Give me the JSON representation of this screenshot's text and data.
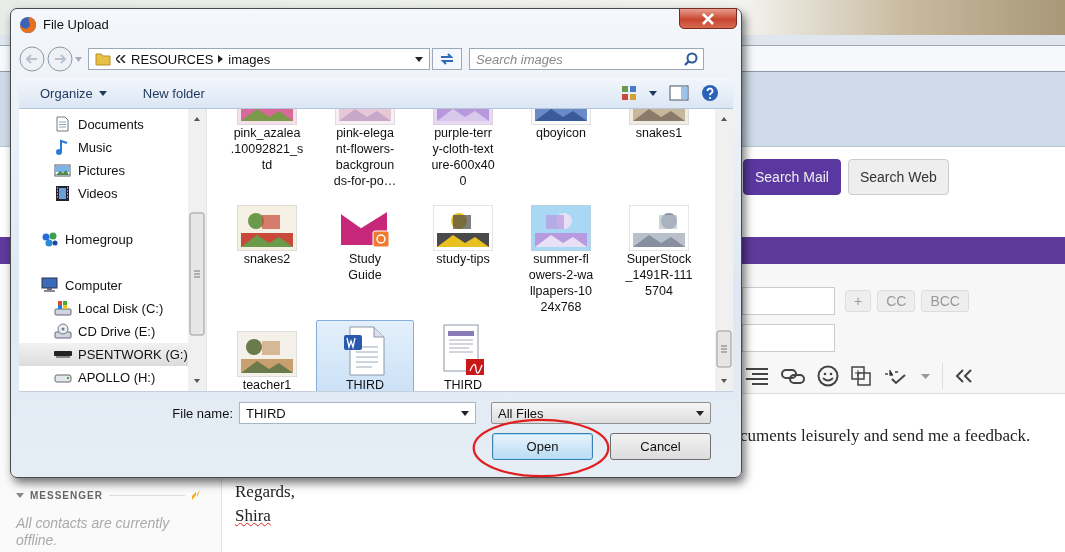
{
  "mail": {
    "search_buttons": [
      {
        "label": "Search Mail",
        "selected": true
      },
      {
        "label": "Search Web",
        "selected": false
      }
    ],
    "recipient_buttons": [
      "+",
      "CC",
      "BCC"
    ],
    "body": {
      "fragment": "cuments leisurely and send me a feedback.",
      "closing": "Regards,",
      "signature": "Shira",
      "signature_misspelled": true
    },
    "messenger": {
      "title": "MESSENGER",
      "status": "All contacts are currently offline."
    }
  },
  "dialog": {
    "title": "File Upload",
    "path": [
      "RESOURCES",
      "images"
    ],
    "search": {
      "placeholder": "Search images"
    },
    "toolbar": [
      {
        "label": "Organize",
        "kind": "menu"
      },
      {
        "label": "New folder",
        "kind": "button"
      }
    ],
    "nav": [
      {
        "children": [
          {
            "label": "Documents",
            "kind": "documents",
            "selected": false
          },
          {
            "label": "Music",
            "kind": "music",
            "selected": false
          },
          {
            "label": "Pictures",
            "kind": "pictures",
            "selected": false
          },
          {
            "label": "Videos",
            "kind": "videos",
            "selected": false
          }
        ]
      },
      {
        "label": "Homegroup",
        "kind": "homegroup",
        "selected": false
      },
      {
        "label": "Computer",
        "kind": "computer",
        "selected": false,
        "children": [
          {
            "label": "Local Disk (C:)",
            "kind": "system-drive",
            "selected": false
          },
          {
            "label": "CD Drive (E:)",
            "kind": "cd-drive",
            "selected": false
          },
          {
            "label": "PSENTWORK (G:)",
            "kind": "network-drive",
            "selected": true
          },
          {
            "label": "APOLLO (H:)",
            "kind": "usb-drive",
            "selected": false
          }
        ]
      }
    ],
    "files": [
      {
        "name": "pink_azalea\n.10092821_s\ntd",
        "kind": "picture",
        "selected": false
      },
      {
        "name": "pink-elega\nnt-flowers-\nbackgroun\nds-for-po…",
        "kind": "picture",
        "selected": false
      },
      {
        "name": "purple-terr\ny-cloth-text\nure-600x40\n0",
        "kind": "picture",
        "selected": false
      },
      {
        "name": "qboyicon",
        "kind": "picture",
        "selected": false
      },
      {
        "name": "snakes1",
        "kind": "picture",
        "selected": false
      },
      {
        "name": "snakes2",
        "kind": "picture",
        "selected": false
      },
      {
        "name": "Study\nGuide",
        "kind": "presentation",
        "selected": false
      },
      {
        "name": "study-tips",
        "kind": "picture",
        "selected": false
      },
      {
        "name": "summer-fl\nowers-2-wa\nllpapers-10\n24x768",
        "kind": "picture",
        "selected": false
      },
      {
        "name": "SuperStock\n_1491R-111\n5704",
        "kind": "picture",
        "selected": false
      },
      {
        "name": "teacher1",
        "kind": "picture",
        "selected": false
      },
      {
        "name": "THIRD",
        "kind": "word",
        "selected": true
      },
      {
        "name": "THIRD",
        "kind": "pdf",
        "selected": false
      }
    ],
    "file_name_label": "File name:",
    "file_name": "THIRD",
    "file_type": "All Files",
    "buttons": [
      {
        "label": "Open",
        "default": true
      },
      {
        "label": "Cancel",
        "default": false
      }
    ]
  }
}
